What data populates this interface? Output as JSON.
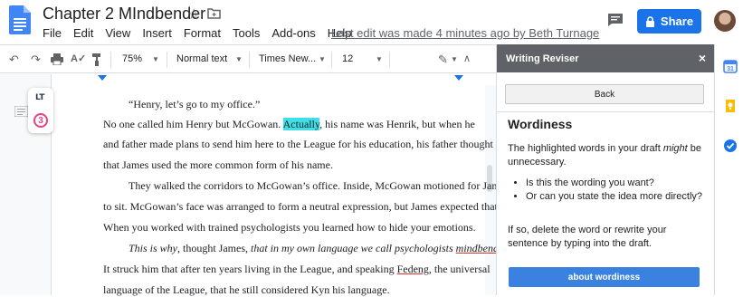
{
  "document": {
    "title": "Chapter 2 MIndbender",
    "last_edit": "Last edit was made 4 minutes ago by Beth Turnage"
  },
  "menu": [
    "File",
    "Edit",
    "View",
    "Insert",
    "Format",
    "Tools",
    "Add-ons",
    "Help"
  ],
  "header": {
    "share_label": "Share"
  },
  "toolbar": {
    "zoom": "75%",
    "style": "Normal text",
    "font": "Times New...",
    "font_size": "12"
  },
  "languagetool": {
    "logo": "LT",
    "issue_count": "3"
  },
  "doc_lines": [
    {
      "parts": [
        {
          "text": "“Henry, let’s go to my office.”"
        }
      ]
    },
    {
      "parts": [
        {
          "text": "No one called him Henry but McGowan. "
        },
        {
          "text": "Actually",
          "style": "highlight"
        },
        {
          "text": ", his name was Henrik, but when he"
        }
      ]
    },
    {
      "parts": [
        {
          "text": "and father made plans to send him here to the League for his education, his father thought it best"
        }
      ]
    },
    {
      "parts": [
        {
          "text": "that James used the more common form of his name."
        }
      ]
    },
    {
      "parts": [
        {
          "text": "They walked the corridors to McGowan’s office. Inside, McGowan motioned for James"
        }
      ]
    },
    {
      "parts": [
        {
          "text": "to sit. McGowan’s face was arranged to form a neutral expression, but James expected that."
        }
      ]
    },
    {
      "parts": [
        {
          "text": "When you worked with trained psychologists you learned how to hide your emotions."
        }
      ]
    },
    {
      "parts": [
        {
          "text": "This is why",
          "style": "italic"
        },
        {
          "text": ", thought James, "
        },
        {
          "text": "that in my own language we call psychologists ",
          "style": "italic"
        },
        {
          "text": "mindbenders",
          "style": "italic-squiggle"
        },
        {
          "text": "."
        }
      ]
    },
    {
      "parts": [
        {
          "text": "It struck him that after ten years living in the League, and speaking "
        },
        {
          "text": "Fedeng",
          "style": "squiggle"
        },
        {
          "text": ", the universal"
        }
      ]
    },
    {
      "parts": [
        {
          "text": "language of the League, that he still considered Kyn his language."
        }
      ]
    }
  ],
  "panel": {
    "title": "Writing Reviser",
    "close": "×",
    "back_label": "Back",
    "heading": "Wordiness",
    "intro_pre": "The highlighted words in your draft ",
    "intro_em": "might",
    "intro_post": " be unnecessary.",
    "bullets": [
      "Is this the wording you want?",
      "Or can you state the idea more directly?"
    ],
    "advice": "If so, delete the word or rewrite your sentence by typing into the draft.",
    "about_label": "about wordiness"
  },
  "colors": {
    "share": "#1a73e8",
    "highlight": "#3ee0e8",
    "panel_header": "#5f6368",
    "about_button": "#3b82e0",
    "lt_badge": "#e8408a"
  }
}
